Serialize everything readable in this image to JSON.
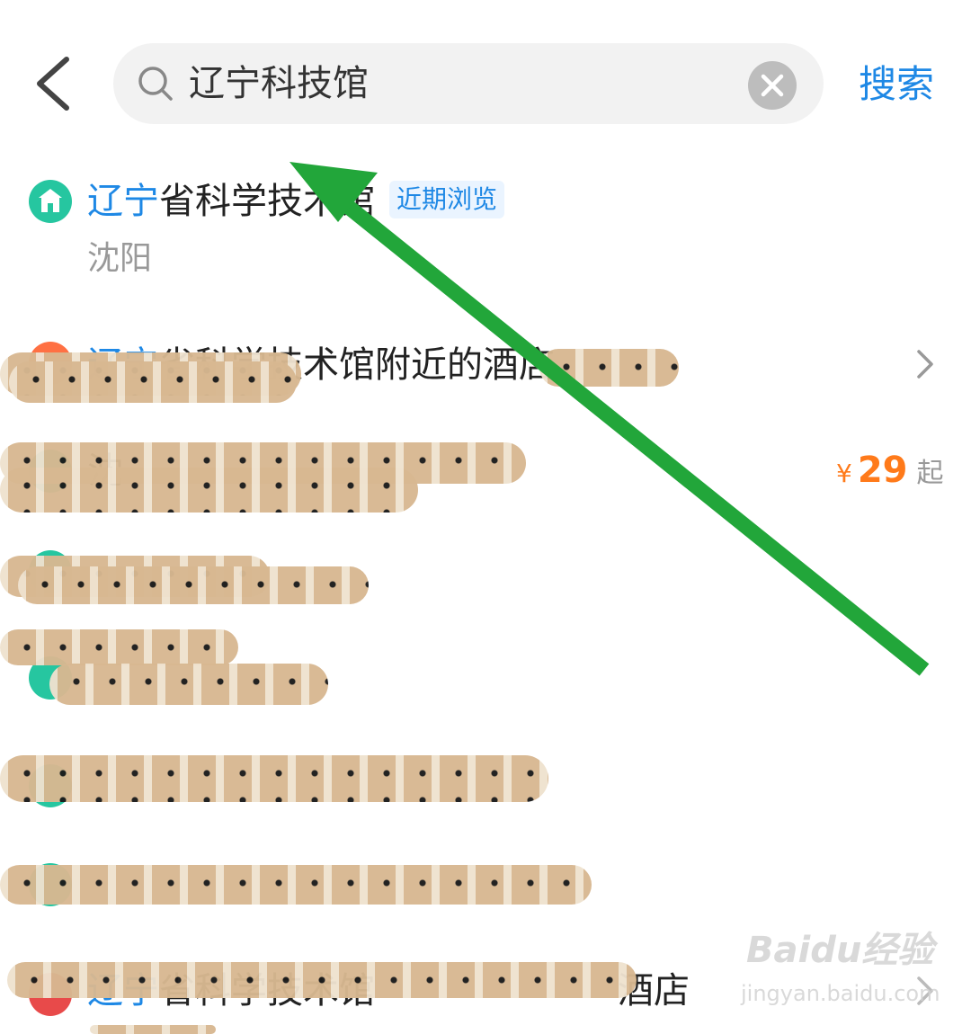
{
  "search": {
    "query": "辽宁科技馆",
    "button_label": "搜索"
  },
  "colors": {
    "accent": "#1e88e5",
    "price": "#ff7a1a",
    "poi_green": "#26c6a0",
    "poi_orange": "#ff7043",
    "poi_red": "#e84a4a",
    "arrow": "#22a63a"
  },
  "results": [
    {
      "icon": "museum-icon",
      "title_highlight": "辽宁",
      "title_rest": "省科学技术馆",
      "badge": "近期浏览",
      "subtitle": "沈阳"
    },
    {
      "icon": "hotel-icon",
      "title_highlight": "辽宁",
      "title_rest": "省科学技术馆附近的酒店"
    },
    {
      "icon": "museum-icon",
      "title_highlight": "",
      "title_rest": "沈",
      "price_currency": "¥",
      "price_amount": "29",
      "price_suffix": "起"
    },
    {
      "icon": "museum-icon",
      "title_highlight": "",
      "title_rest": ""
    },
    {
      "icon": "museum-icon",
      "title_highlight": "",
      "title_rest": ""
    },
    {
      "icon": "museum-icon",
      "title_highlight": "",
      "title_rest": ""
    },
    {
      "icon": "museum-icon",
      "title_highlight": "",
      "title_rest": ""
    },
    {
      "icon": "hotel-icon",
      "title_highlight": "辽宁",
      "title_rest": "省科学技术馆",
      "title_tail": "酒店"
    }
  ],
  "watermark": {
    "logo_text": "Baidu经验",
    "url": "jingyan.baidu.com"
  }
}
